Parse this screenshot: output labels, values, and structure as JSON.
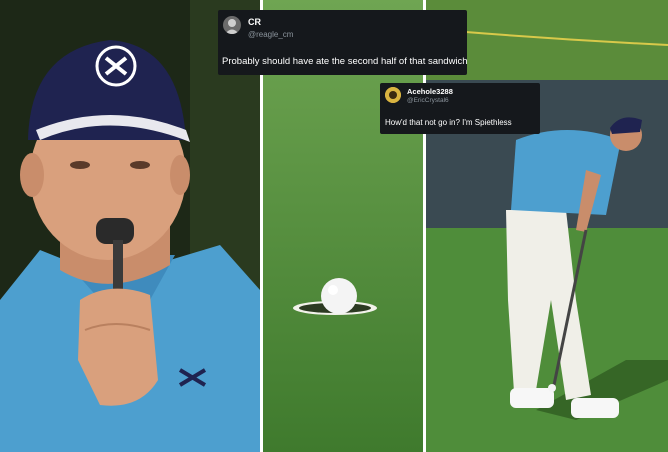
{
  "tweets": [
    {
      "name": "CR",
      "handle": "@reagle_cm",
      "text": "Probably should have ate the second half of that sandwich"
    },
    {
      "name": "Acehole3288",
      "handle": "@EricCrystal6",
      "text": "How'd that not go in? I'm Spiethless"
    }
  ],
  "colors": {
    "tweet_bg": "#15181c",
    "grass": "#4f8a39",
    "cap": "#1f2350",
    "shirt": "#4d9fcf"
  },
  "icons": [
    "under-armour-logo-icon",
    "golf-ball-icon"
  ]
}
